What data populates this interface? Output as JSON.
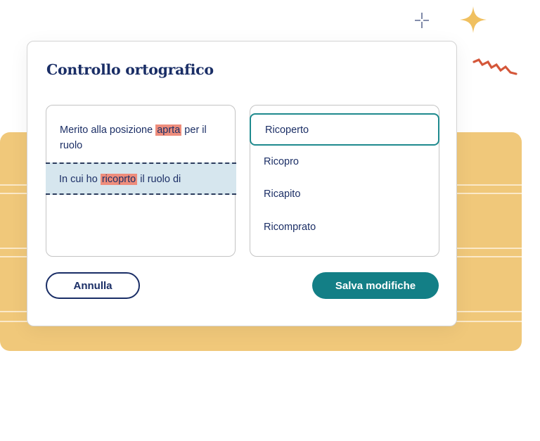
{
  "dialog": {
    "title": "Controllo ortografico"
  },
  "sentences": [
    {
      "before": "Merito alla posizione ",
      "error": "aprta",
      "after": " per il ruolo",
      "selected": false
    },
    {
      "before": "In cui ho ",
      "error": "ricoprto",
      "after": " il ruolo di",
      "selected": true
    }
  ],
  "suggestions": [
    {
      "label": "Ricoperto",
      "selected": true
    },
    {
      "label": "Ricopro",
      "selected": false
    },
    {
      "label": "Ricapito",
      "selected": false
    },
    {
      "label": "Ricomprato",
      "selected": false
    }
  ],
  "buttons": {
    "cancel": "Annulla",
    "save": "Salva modifiche"
  },
  "colors": {
    "title": "#1a2e66",
    "accent_teal": "#137f86",
    "error_highlight": "#ee8d7c",
    "selected_sentence_bg": "#d6e6ee",
    "backdrop_yellow": "#f0c87a",
    "sparkle_gold": "#f0c060",
    "zigzag_red": "#d4573a"
  },
  "decorations": [
    "crosshair-sparkle-icon",
    "four-point-star-icon",
    "zigzag-icon"
  ]
}
